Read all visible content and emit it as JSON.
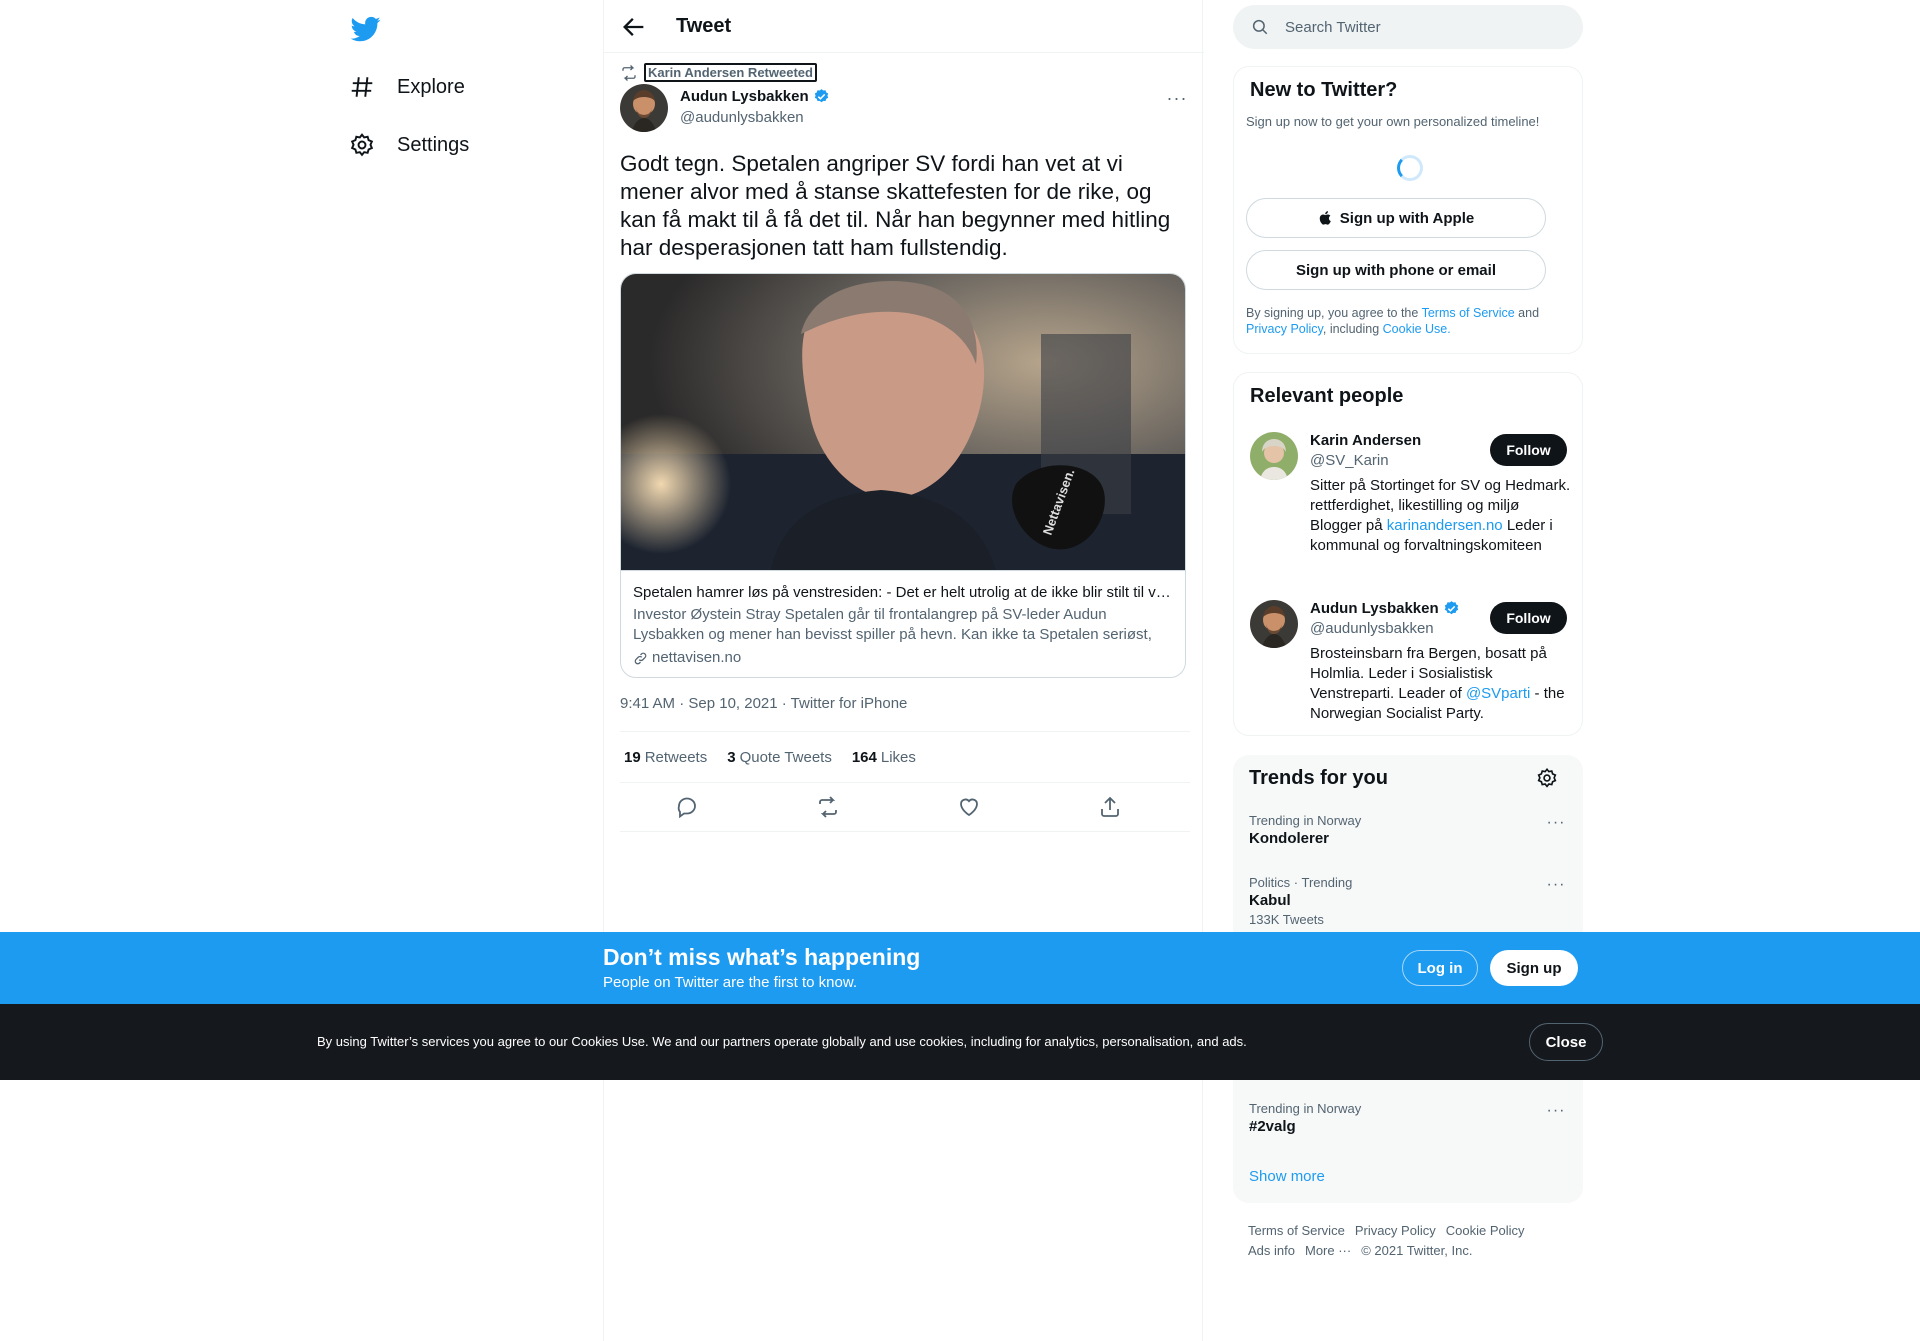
{
  "nav": {
    "items": [
      {
        "label": "Explore",
        "icon": "hashtag-icon"
      },
      {
        "label": "Settings",
        "icon": "gear-icon"
      }
    ]
  },
  "header": {
    "title": "Tweet"
  },
  "tweet": {
    "retweeted_by": "Karin Andersen Retweeted",
    "author_name": "Audun Lysbakken",
    "author_handle": "@audunlysbakken",
    "verified": true,
    "text": "Godt tegn. Spetalen angriper SV fordi han vet at vi mener alvor med å stanse skattefesten for de rike, og kan få makt til å få det til. Når han begynner med hitling har desperasjonen tatt ham fullstendig.",
    "card": {
      "title": "Spetalen hamrer løs på venstresiden: - Det er helt utrolig at de ikke blir stilt til veggs",
      "description": "Investor Øystein Stray Spetalen går til frontalangrep på SV-leder Audun Lysbakken og mener han bevisst spiller på hevn. Kan ikke ta Spetalen seriøst, sier Lysbakken.",
      "domain": "nettavisen.no",
      "image_text": "Nettavisen."
    },
    "timestamp": "9:41 AM · Sep 10, 2021 · Twitter for iPhone",
    "stats": [
      {
        "count": "19",
        "label": "Retweets"
      },
      {
        "count": "3",
        "label": "Quote Tweets"
      },
      {
        "count": "164",
        "label": "Likes"
      }
    ]
  },
  "search": {
    "placeholder": "Search Twitter"
  },
  "new_to_twitter": {
    "title": "New to Twitter?",
    "subtitle": "Sign up now to get your own personalized timeline!",
    "apple_label": "Sign up with Apple",
    "phone_label": "Sign up with phone or email",
    "legal_prefix": "By signing up, you agree to the ",
    "terms": "Terms of Service",
    "and": " and ",
    "privacy": "Privacy Policy",
    "including": ", including ",
    "cookie_use": "Cookie Use."
  },
  "relevant_people": {
    "title": "Relevant people",
    "people": [
      {
        "name": "Karin Andersen",
        "handle": "@SV_Karin",
        "verified": false,
        "bio_prefix": "Sitter på Stortinget for SV og Hedmark. rettferdighet, likestilling og miljø Blogger på ",
        "bio_link": "karinandersen.no",
        "bio_suffix": " Leder i kommunal og forvaltningskomiteen",
        "follow_label": "Follow"
      },
      {
        "name": "Audun Lysbakken",
        "handle": "@audunlysbakken",
        "verified": true,
        "bio_prefix": "Brosteinsbarn fra Bergen, bosatt på Holmlia. Leder i Sosialistisk Venstreparti. Leader of ",
        "bio_link": "@SVparti",
        "bio_suffix": " - the Norwegian Socialist Party.",
        "follow_label": "Follow"
      }
    ]
  },
  "trends": {
    "title": "Trends for you",
    "items": [
      {
        "meta": "Trending in Norway",
        "name": "Kondolerer",
        "count": ""
      },
      {
        "meta": "Politics · Trending",
        "name": "Kabul",
        "count": "133K Tweets"
      },
      {
        "meta": "Trending in Norway",
        "name": "#2valg",
        "count": ""
      }
    ],
    "show_more": "Show more"
  },
  "footer": {
    "links": [
      "Terms of Service",
      "Privacy Policy",
      "Cookie Policy",
      "Ads info",
      "More ···",
      "© 2021 Twitter, Inc."
    ]
  },
  "banner": {
    "title": "Don’t miss what’s happening",
    "subtitle": "People on Twitter are the first to know.",
    "login": "Log in",
    "signup": "Sign up"
  },
  "cookie": {
    "text": "By using Twitter’s services you agree to our Cookies Use. We and our partners operate globally and use cookies, including for analytics, personalisation, and ads.",
    "close": "Close"
  },
  "colors": {
    "accent": "#1d9bf0",
    "text": "#0f1419",
    "muted": "#536471",
    "cookie_bg": "#15181c"
  }
}
